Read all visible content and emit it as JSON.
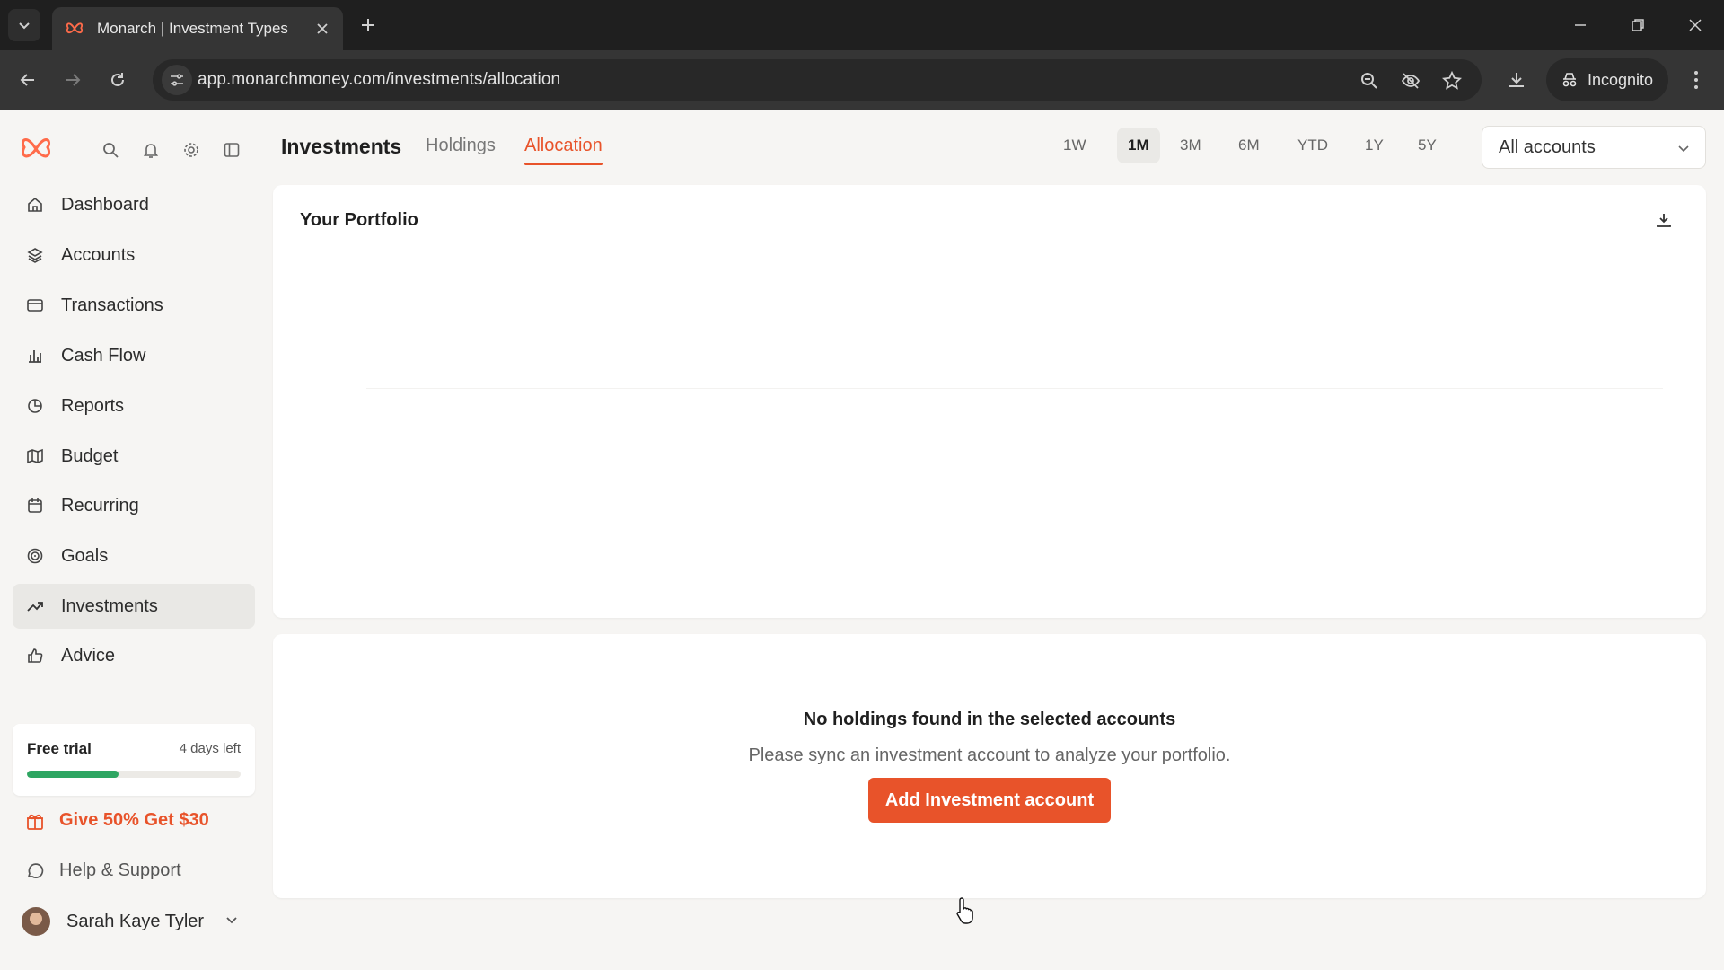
{
  "browser": {
    "tab_title": "Monarch | Investment Types",
    "url": "app.monarchmoney.com/investments/allocation",
    "incognito_label": "Incognito"
  },
  "colors": {
    "accent": "#e8532a",
    "progress": "#2ea662"
  },
  "sidebar": {
    "items": [
      {
        "label": "Dashboard",
        "icon": "home-icon"
      },
      {
        "label": "Accounts",
        "icon": "layers-icon"
      },
      {
        "label": "Transactions",
        "icon": "card-icon"
      },
      {
        "label": "Cash Flow",
        "icon": "bar-chart-icon"
      },
      {
        "label": "Reports",
        "icon": "pie-chart-icon"
      },
      {
        "label": "Budget",
        "icon": "map-icon"
      },
      {
        "label": "Recurring",
        "icon": "calendar-icon"
      },
      {
        "label": "Goals",
        "icon": "target-icon"
      },
      {
        "label": "Investments",
        "icon": "trend-up-icon",
        "active": true
      },
      {
        "label": "Advice",
        "icon": "thumbs-up-icon"
      }
    ],
    "trial": {
      "label": "Free trial",
      "days_left": "4 days left",
      "progress_fraction": 0.43
    },
    "referral": "Give 50% Get $30",
    "help": "Help & Support",
    "user_name": "Sarah Kaye Tyler"
  },
  "header": {
    "title": "Investments",
    "tabs": [
      "Holdings",
      "Allocation"
    ],
    "active_tab": "Allocation",
    "ranges": [
      "1W",
      "1M",
      "3M",
      "6M",
      "YTD",
      "1Y",
      "5Y"
    ],
    "active_range": "1M",
    "account_filter": "All accounts"
  },
  "portfolio": {
    "title": "Your Portfolio"
  },
  "holdings": {
    "empty_title": "No holdings found in the selected accounts",
    "empty_subtitle": "Please sync an investment account to analyze your portfolio.",
    "add_button": "Add Investment account"
  }
}
